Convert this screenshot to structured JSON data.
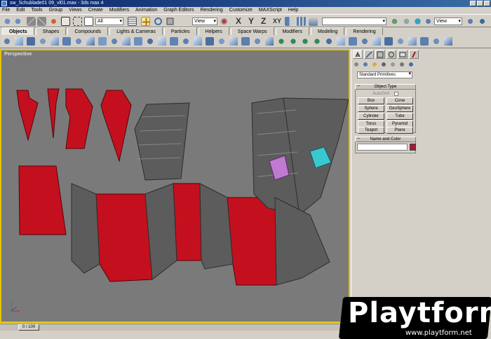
{
  "title_bar": {
    "title": "sw_Schublade01 09_vl01.max - 3ds max 4"
  },
  "menu": [
    "File",
    "Edit",
    "Tools",
    "Group",
    "Views",
    "Create",
    "Modifiers",
    "Animation",
    "Graph Editors",
    "Rendering",
    "Customize",
    "MAXScript",
    "Help"
  ],
  "toolbar": {
    "selection_filter": "All",
    "ref_coord": "View",
    "axis_letters": [
      "X",
      "Y",
      "Z",
      "XY"
    ],
    "named_selection": "",
    "render_view": "View"
  },
  "tabs": [
    "Objects",
    "Shapes",
    "Compounds",
    "Lights & Cameras",
    "Particles",
    "Helpers",
    "Space Warps",
    "Modifiers",
    "Modeling",
    "Rendering"
  ],
  "active_tab": "Objects",
  "viewport": {
    "label": "Perspective"
  },
  "time_slider": {
    "label": "0 / 100"
  },
  "command_panel": {
    "primitive_type": "Standard Primitives",
    "object_type": {
      "title": "Object Type",
      "autogrid_label": "AutoGrid",
      "buttons": [
        "Box",
        "Cone",
        "Sphere",
        "GeoSphere",
        "Cylinder",
        "Tube",
        "Torus",
        "Pyramid",
        "Teapot",
        "Plane"
      ]
    },
    "name_and_color": {
      "title": "Name and Color",
      "name_value": "",
      "color": "#a01a3a"
    }
  },
  "watermark": {
    "brand": "Playtform",
    "url": "www.playtform.net"
  },
  "colors": {
    "accent_red": "#c4101e",
    "viewport_bg": "#7a7a7a",
    "active_border": "#e5c300"
  }
}
